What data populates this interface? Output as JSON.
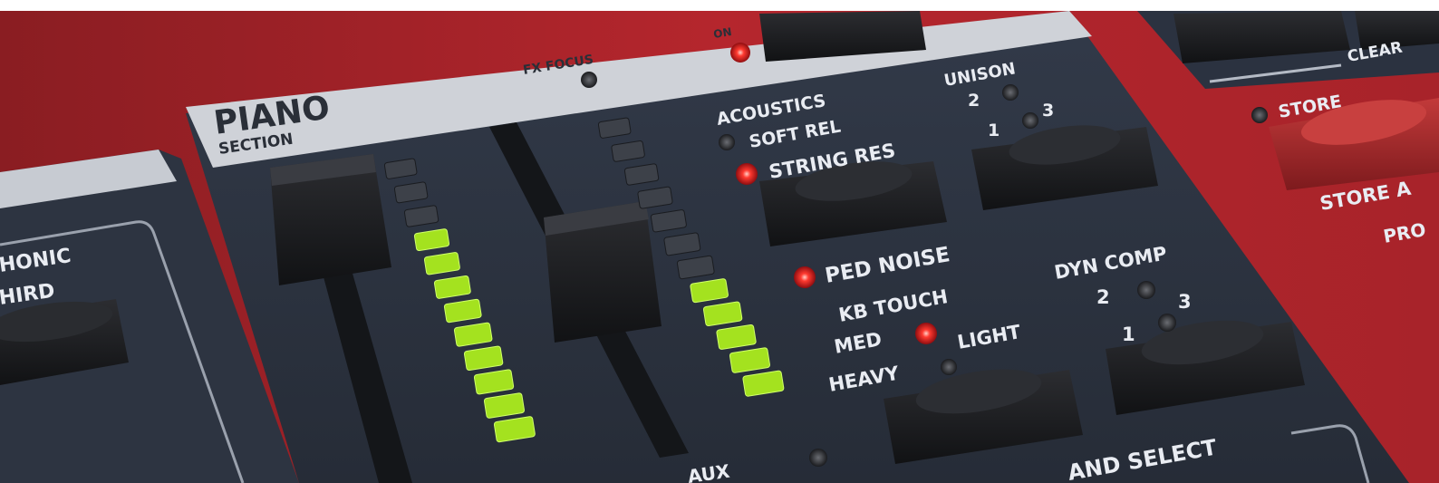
{
  "photo": {
    "subject": "Synth panel close-up",
    "colors": {
      "body_red": "#b8222a",
      "panel_navy": "#2b3240",
      "strip_grey": "#c9ccd3",
      "led_red": "#ff2a2a",
      "led_green": "#9be21c",
      "button_black": "#1c1d20"
    }
  },
  "labels": {
    "fx_focus": "FX FOCUS",
    "on": "ON",
    "piano": "PIANO",
    "section": "SECTION",
    "acoustics": "ACOUSTICS",
    "soft_rel": "SOFT REL",
    "string_res": "STRING RES",
    "ped_noise": "PED NOISE",
    "kb_touch": "KB TOUCH",
    "med": "MED",
    "light": "LIGHT",
    "heavy": "HEAVY",
    "unison": "UNISON",
    "unison_1": "1",
    "unison_2": "2",
    "unison_3": "3",
    "dyn_comp": "DYN COMP",
    "dyn_1": "1",
    "dyn_2": "2",
    "dyn_3": "3",
    "harmonic": "HONIC",
    "third": "HIRD",
    "store": "STORE",
    "store_as": "STORE A",
    "prog": "PRO",
    "clear": "CLEAR",
    "bottom_select": "AND SELECT",
    "bottom_left": "AUX"
  },
  "indicators": {
    "meter_left_lit_segments": 9,
    "meter_left_total_segments": 12,
    "meter_right_lit_segments": 5,
    "meter_right_total_segments": 12,
    "on_led": "lit",
    "string_res_led": "lit",
    "ped_noise_led": "lit",
    "kb_touch_med_led": "lit"
  }
}
